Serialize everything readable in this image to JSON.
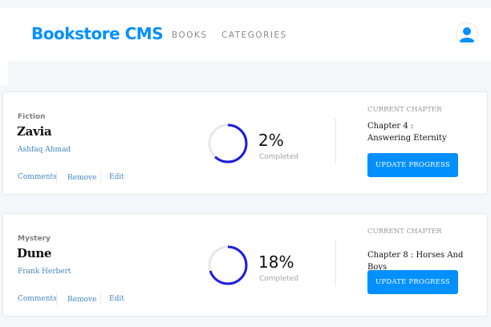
{
  "header": {
    "logo": "Bookstore CMS",
    "nav": [
      "BOOKS",
      "CATEGORIES"
    ]
  },
  "colors": {
    "accent": "#0290ff",
    "link": "#4386bf",
    "progress": "#1b1dde",
    "track": "#e8e8e8"
  },
  "books": [
    {
      "genre": "Fiction",
      "title": "Zavia",
      "author": "Ashfaq Ahmad",
      "actions": [
        "Comments",
        "Remove",
        "Edit"
      ],
      "percent_label": "2%",
      "progress_fraction": 0.62,
      "completed_label": "Completed",
      "chapter_label": "CURRENT CHAPTER",
      "chapter": "Chapter 4 : Answering Eternity",
      "button": "UPDATE PROGRESS"
    },
    {
      "genre": "Mystery",
      "title": "Dune",
      "author": "Frank Herbert",
      "actions": [
        "Comments",
        "Remove",
        "Edit"
      ],
      "percent_label": "18%",
      "progress_fraction": 0.7,
      "completed_label": "Completed",
      "chapter_label": "CURRENT CHAPTER",
      "chapter": "Chapter 8 : Horses And Boys",
      "button": "UPDATE PROGRESS"
    }
  ]
}
